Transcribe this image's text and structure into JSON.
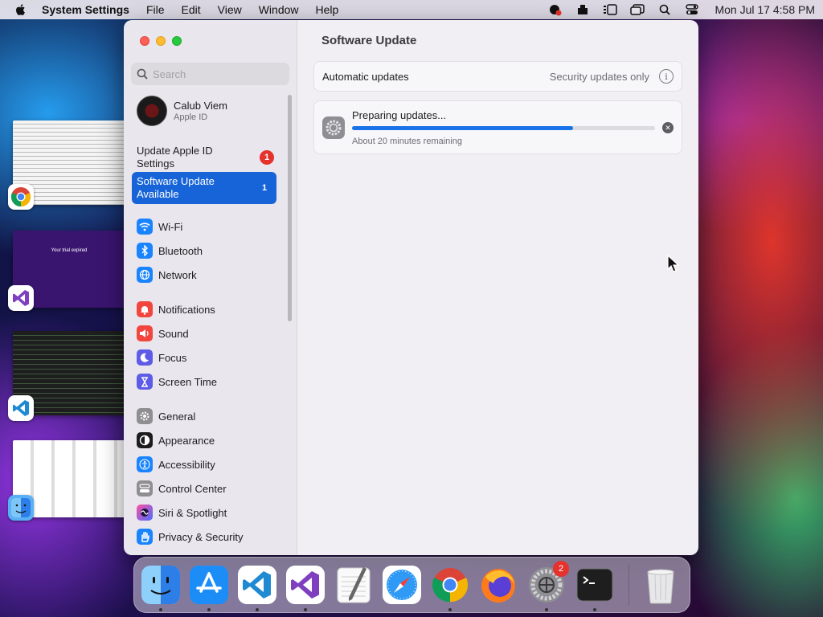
{
  "menubar": {
    "app_name": "System Settings",
    "menus": [
      "File",
      "Edit",
      "View",
      "Window",
      "Help"
    ],
    "clock": "Mon Jul 17  4:58 PM"
  },
  "sidebar": {
    "search_placeholder": "Search",
    "account": {
      "name": "Calub Viem",
      "subtitle": "Apple ID"
    },
    "notices": [
      {
        "label": "Update Apple ID Settings",
        "badge": "1"
      },
      {
        "label": "Software Update Available",
        "badge": "1"
      }
    ],
    "groups": [
      [
        {
          "label": "Wi-Fi",
          "icon": "wifi-icon",
          "color": "#1a84ff"
        },
        {
          "label": "Bluetooth",
          "icon": "bluetooth-icon",
          "color": "#1a84ff"
        },
        {
          "label": "Network",
          "icon": "globe-icon",
          "color": "#1a84ff"
        }
      ],
      [
        {
          "label": "Notifications",
          "icon": "bell-icon",
          "color": "#f2453d"
        },
        {
          "label": "Sound",
          "icon": "speaker-icon",
          "color": "#f2453d"
        },
        {
          "label": "Focus",
          "icon": "moon-icon",
          "color": "#5e5ce6"
        },
        {
          "label": "Screen Time",
          "icon": "hourglass-icon",
          "color": "#5e5ce6"
        }
      ],
      [
        {
          "label": "General",
          "icon": "gear-icon",
          "color": "#8e8e93"
        },
        {
          "label": "Appearance",
          "icon": "appearance-icon",
          "color": "#1c1c1e"
        },
        {
          "label": "Accessibility",
          "icon": "accessibility-icon",
          "color": "#1a84ff"
        },
        {
          "label": "Control Center",
          "icon": "control-center-icon",
          "color": "#8e8e93"
        },
        {
          "label": "Siri & Spotlight",
          "icon": "siri-icon",
          "color": "#7b3fd9"
        },
        {
          "label": "Privacy & Security",
          "icon": "hand-icon",
          "color": "#1a84ff"
        }
      ]
    ]
  },
  "content": {
    "title": "Software Update",
    "automatic": {
      "label": "Automatic updates",
      "value": "Security updates only"
    },
    "progress": {
      "title": "Preparing updates...",
      "subtitle": "About 20 minutes remaining",
      "fraction": 0.73
    },
    "help": "?"
  },
  "desktop": {
    "purple_thumb_text": "Your trial expired"
  },
  "dock": {
    "apps": [
      {
        "name": "finder",
        "running": true
      },
      {
        "name": "app-store",
        "running": true
      },
      {
        "name": "vscode",
        "running": true
      },
      {
        "name": "visual-studio",
        "running": true
      },
      {
        "name": "textedit",
        "running": false
      },
      {
        "name": "safari",
        "running": false
      },
      {
        "name": "chrome",
        "running": true
      },
      {
        "name": "firefox",
        "running": false
      },
      {
        "name": "system-settings",
        "running": true,
        "badge": "2"
      },
      {
        "name": "terminal",
        "running": true
      }
    ],
    "trash": "trash"
  }
}
